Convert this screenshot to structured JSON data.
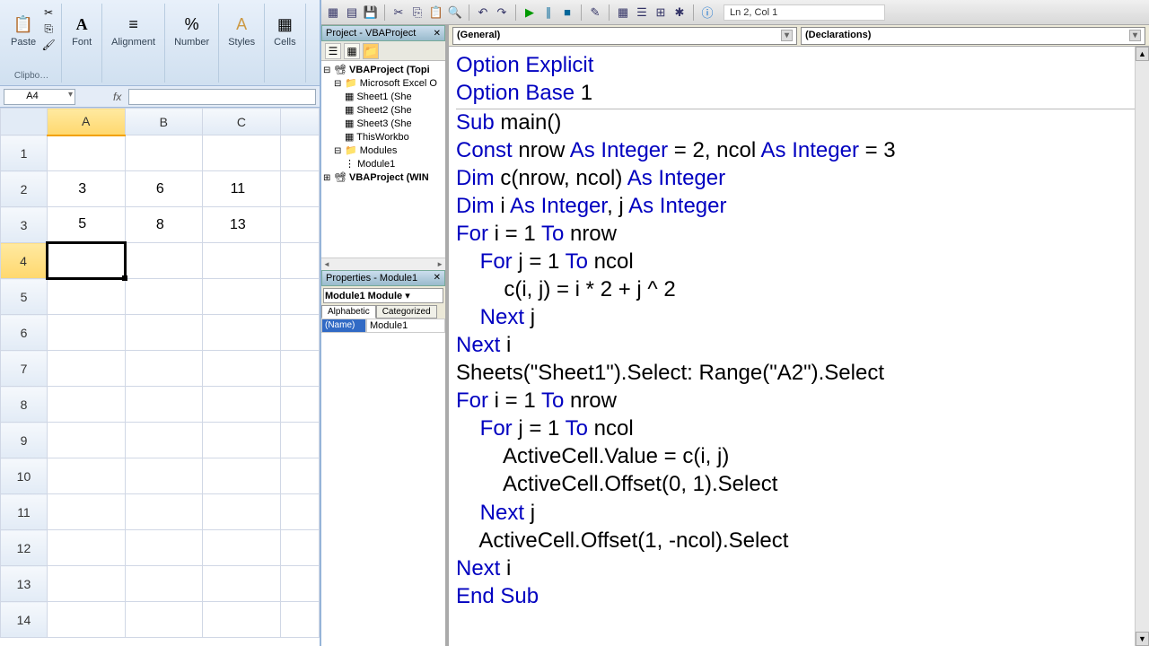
{
  "ribbon": {
    "paste": "Paste",
    "font": "Font",
    "alignment": "Alignment",
    "number": "Number",
    "styles": "Styles",
    "cells": "Cells",
    "clip_group": "Clipbo…"
  },
  "formula_bar": {
    "name_box": "A4",
    "fx": "fx",
    "formula": ""
  },
  "sheet": {
    "cols": [
      "A",
      "B",
      "C"
    ],
    "rows": [
      "1",
      "2",
      "3",
      "4",
      "5",
      "6",
      "7",
      "8",
      "9",
      "10",
      "11",
      "12",
      "13",
      "14"
    ],
    "data": {
      "2": {
        "A": "3",
        "B": "6",
        "C": "11"
      },
      "3": {
        "A": "5",
        "B": "8",
        "C": "13"
      }
    },
    "active": "A4"
  },
  "vbe": {
    "cursor": "Ln 2, Col 1",
    "project_title": "Project - VBAProject",
    "tree": {
      "root1": "VBAProject (Topi",
      "excel_objects": "Microsoft Excel O",
      "sheet1": "Sheet1 (She",
      "sheet2": "Sheet2 (She",
      "sheet3": "Sheet3 (She",
      "thiswb": "ThisWorkbo",
      "modules": "Modules",
      "module1": "Module1",
      "root2": "VBAProject (WIN"
    },
    "props_title": "Properties - Module1",
    "props_combo": "Module1 Module",
    "props_tab_a": "Alphabetic",
    "props_tab_c": "Categorized",
    "props_name_key": "(Name)",
    "props_name_val": "Module1",
    "dd_left": "(General)",
    "dd_right": "(Declarations)",
    "code": {
      "l1a": "Option Explicit",
      "l2a": "Option Base",
      "l2b": " 1",
      "l3a": "Sub",
      "l3b": " main()",
      "l4a": "Const",
      "l4b": " nrow ",
      "l4c": "As Integer",
      "l4d": " = 2, ncol ",
      "l4e": "As Integer",
      "l4f": " = 3",
      "l5a": "Dim",
      "l5b": " c(nrow, ncol) ",
      "l5c": "As Integer",
      "l6a": "Dim",
      "l6b": " i ",
      "l6c": "As Integer",
      "l6d": ", j ",
      "l6e": "As Integer",
      "l7a": "For",
      "l7b": " i = 1 ",
      "l7c": "To",
      "l7d": " nrow",
      "l8a": "    For",
      "l8b": " j = 1 ",
      "l8c": "To",
      "l8d": " ncol",
      "l9": "        c(i, j) = i * 2 + j ^ 2",
      "l10a": "    Next",
      "l10b": " j",
      "l11a": "Next",
      "l11b": " i",
      "l12": "Sheets(\"Sheet1\").Select: Range(\"A2\").Select",
      "l13a": "For",
      "l13b": " i = 1 ",
      "l13c": "To",
      "l13d": " nrow",
      "l14a": "    For",
      "l14b": " j = 1 ",
      "l14c": "To",
      "l14d": " ncol",
      "l15": "        ActiveCell.Value = c(i, j)",
      "l16": "        ActiveCell.Offset(0, 1).Select",
      "l17a": "    Next",
      "l17b": " j",
      "l18": "    ActiveCell.Offset(1, -ncol).Select",
      "l19a": "Next",
      "l19b": " i",
      "l20a": "End Sub"
    }
  }
}
